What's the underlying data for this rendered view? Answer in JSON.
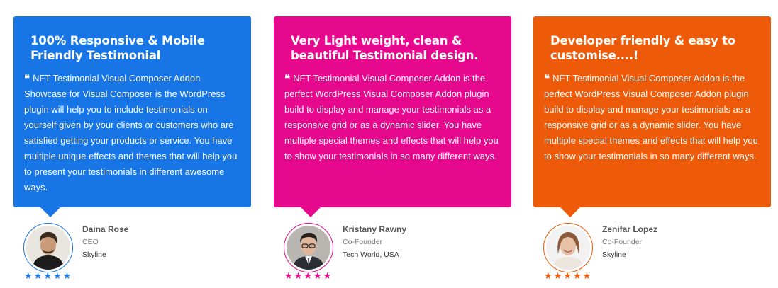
{
  "cards": [
    {
      "title": "100% Responsive & Mobile Friendly Testimonial",
      "text": "NFT Testimonial Visual Composer Addon Showcase for Visual Composer is the WordPress plugin will help you to include testimonials on yourself given by your clients or customers who are satisfied getting your products or service. You have multiple unique effects and themes that will help you to present your testimonials in different awesome ways.",
      "color": "#1875e6",
      "person": {
        "name": "Daina Rose",
        "role": "CEO",
        "company": "Skyline"
      },
      "rating": 5,
      "star_color": "#1875e6"
    },
    {
      "title": "Very Light weight, clean & beautiful Testimonial design.",
      "text": "NFT Testimonial Visual Composer Addon is the perfect WordPress Visual Composer Addon plugin build to display and manage your testimonials as a responsive grid or as a dynamic slider. You have multiple special themes and effects that will help you to show your testimonials in so many different ways.",
      "color": "#e6088d",
      "person": {
        "name": "Kristany Rawny",
        "role": "Co-Founder",
        "company": "Tech World, USA"
      },
      "rating": 5,
      "star_color": "#e6088d"
    },
    {
      "title": "Developer friendly & easy to customise....!",
      "text": "NFT Testimonial Visual Composer Addon is the perfect WordPress Visual Composer Addon plugin build to display and manage your testimonials as a responsive grid or as a dynamic slider. You have multiple special themes and effects that will help you to show your testimonials in so many different ways.",
      "color": "#ec5a0a",
      "person": {
        "name": "Zenifar Lopez",
        "role": "Co-Founder",
        "company": "Skyline"
      },
      "rating": 5,
      "star_color": "#ec5a0a"
    }
  ],
  "icons": {
    "quote": "quote-left-icon",
    "star": "star-icon",
    "avatar": "avatar-photo"
  }
}
